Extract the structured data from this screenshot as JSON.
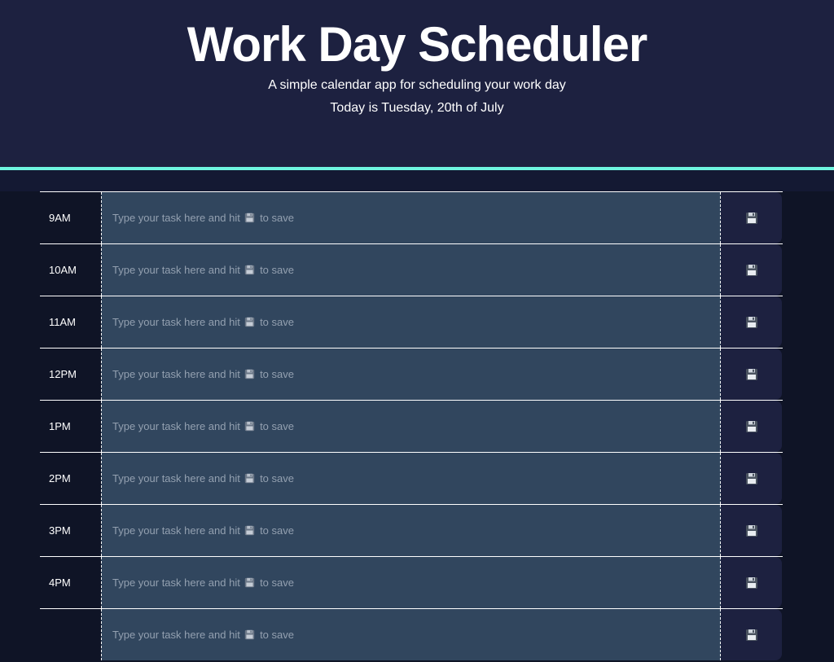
{
  "header": {
    "title": "Work Day Scheduler",
    "subtitle": "A simple calendar app for scheduling your work day",
    "today": "Today is Tuesday, 20th of July"
  },
  "placeholder": {
    "before_icon": "Type your task here and hit",
    "icon": "floppy-disk-icon",
    "after_icon": "to save"
  },
  "rows": [
    {
      "hour": "9AM",
      "task": ""
    },
    {
      "hour": "10AM",
      "task": ""
    },
    {
      "hour": "11AM",
      "task": ""
    },
    {
      "hour": "12PM",
      "task": ""
    },
    {
      "hour": "1PM",
      "task": ""
    },
    {
      "hour": "2PM",
      "task": ""
    },
    {
      "hour": "3PM",
      "task": ""
    },
    {
      "hour": "4PM",
      "task": ""
    },
    {
      "hour": "",
      "task": ""
    }
  ],
  "save_icon": "floppy-disk-icon",
  "colors": {
    "header_bg": "#1d2140",
    "accent": "#6ff5e0",
    "task_bg": "#31465e",
    "page_bg": "#0f1426"
  }
}
